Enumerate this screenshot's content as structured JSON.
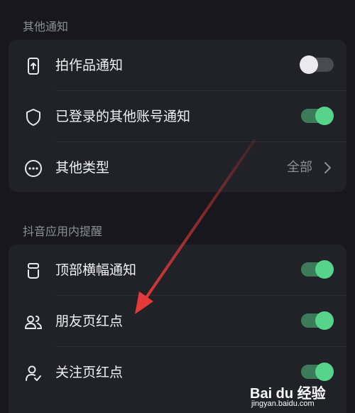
{
  "sections": [
    {
      "title": "其他通知",
      "items": [
        {
          "label": "拍作品通知",
          "icon": "phone-upload-icon",
          "control": "toggle",
          "on": false
        },
        {
          "label": "已登录的其他账号通知",
          "icon": "shield-icon",
          "control": "toggle",
          "on": true
        },
        {
          "label": "其他类型",
          "icon": "more-circle-icon",
          "control": "link",
          "value": "全部"
        }
      ]
    },
    {
      "title": "抖音应用内提醒",
      "items": [
        {
          "label": "顶部横幅通知",
          "icon": "banner-icon",
          "control": "toggle",
          "on": true
        },
        {
          "label": "朋友页红点",
          "icon": "friends-icon",
          "control": "toggle",
          "on": true
        },
        {
          "label": "关注页红点",
          "icon": "user-follow-icon",
          "control": "toggle",
          "on": true
        }
      ]
    }
  ],
  "colors": {
    "background": "#17171d",
    "card": "#212128",
    "toggle_on": "#57d48c",
    "annotation_arrow": "#e63a3a"
  },
  "watermark": {
    "main": "Bai du 经验",
    "sub": "jingyan.baidu.com"
  }
}
